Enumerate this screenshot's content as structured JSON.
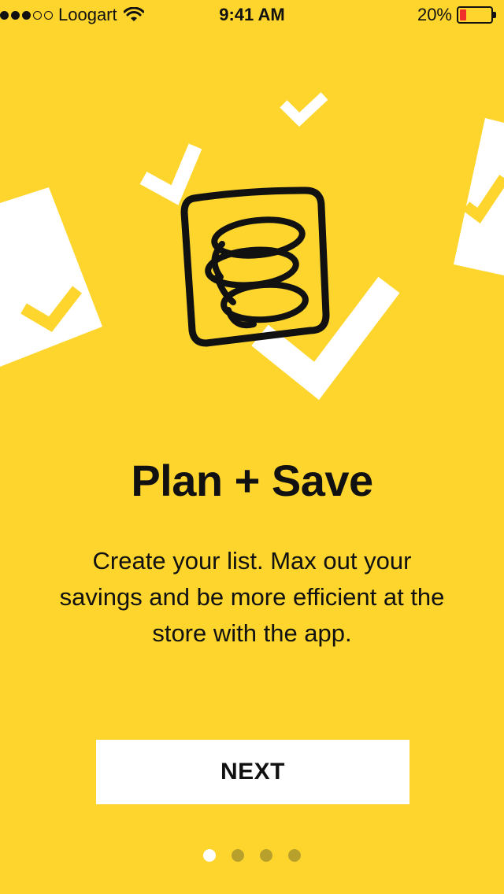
{
  "status_bar": {
    "carrier": "Loogart",
    "signal_bars_filled": 3,
    "signal_bars_total": 5,
    "time": "9:41 AM",
    "battery_percent": "20%",
    "battery_level": 0.2
  },
  "illustration": {
    "main_icon": "spiral-notepad-icon",
    "decorations": [
      "checkmark-icon",
      "paper-sheet-icon"
    ]
  },
  "onboarding": {
    "title": "Plan + Save",
    "description": "Create your list. Max out your savings and be more efficient at the store with the app.",
    "next_label": "NEXT"
  },
  "pagination": {
    "total_pages": 4,
    "current_page": 1
  },
  "colors": {
    "background": "#FDD52D",
    "accent_white": "#FFFFFF",
    "text": "#111111",
    "inactive_dot": "#B8A02D",
    "battery_low": "#F0302A"
  }
}
